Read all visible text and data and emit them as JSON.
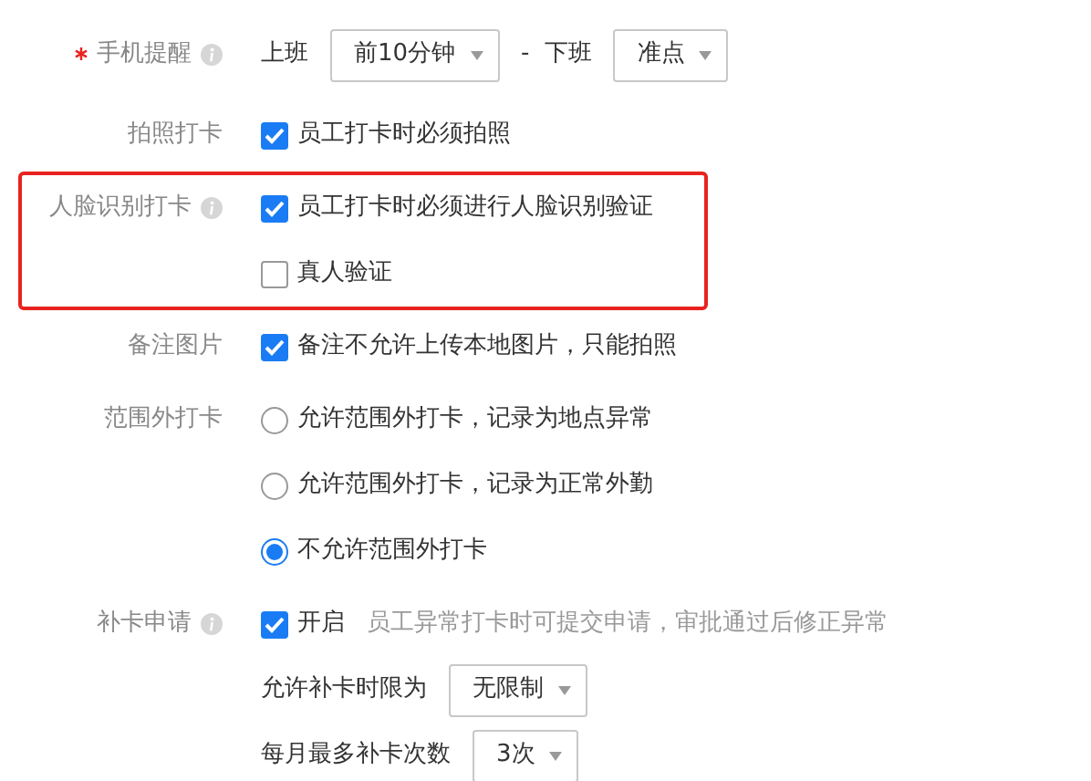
{
  "rows": [
    {
      "label": "手机提醒",
      "required": true,
      "info": true,
      "highlighted": false,
      "lines": [
        [
          {
            "kind": "text",
            "text": "上班"
          },
          {
            "kind": "select",
            "value": "前10分钟"
          },
          {
            "kind": "text",
            "text": "-"
          },
          {
            "kind": "text",
            "text": "下班"
          },
          {
            "kind": "select",
            "value": "准点"
          }
        ]
      ]
    },
    {
      "label": "拍照打卡",
      "required": false,
      "info": false,
      "highlighted": false,
      "lines": [
        [
          {
            "kind": "checkbox",
            "text": "员工打卡时必须拍照",
            "checked": true
          }
        ]
      ]
    },
    {
      "label": "人脸识别打卡",
      "required": false,
      "info": true,
      "highlighted": true,
      "lines": [
        [
          {
            "kind": "checkbox",
            "text": "员工打卡时必须进行人脸识别验证",
            "checked": true
          }
        ],
        [
          {
            "kind": "checkbox",
            "text": "真人验证",
            "checked": false
          }
        ]
      ]
    },
    {
      "label": "备注图片",
      "required": false,
      "info": false,
      "highlighted": false,
      "lines": [
        [
          {
            "kind": "checkbox",
            "text": "备注不允许上传本地图片，只能拍照",
            "checked": true
          }
        ]
      ]
    },
    {
      "label": "范围外打卡",
      "required": false,
      "info": false,
      "highlighted": false,
      "lines": [
        [
          {
            "kind": "radio",
            "text": "允许范围外打卡，记录为地点异常",
            "selected": false
          }
        ],
        [
          {
            "kind": "radio",
            "text": "允许范围外打卡，记录为正常外勤",
            "selected": false
          }
        ],
        [
          {
            "kind": "radio",
            "text": "不允许范围外打卡",
            "selected": true
          }
        ]
      ]
    },
    {
      "label": "补卡申请",
      "required": false,
      "info": true,
      "highlighted": false,
      "lines": [
        [
          {
            "kind": "checkbox",
            "text": "开启",
            "checked": true
          },
          {
            "kind": "hint",
            "text": "员工异常打卡时可提交申请，审批通过后修正异常"
          }
        ],
        [
          {
            "kind": "text",
            "text": "允许补卡时限为"
          },
          {
            "kind": "select",
            "value": "无限制"
          }
        ],
        [
          {
            "kind": "text",
            "text": "每月最多补卡次数"
          },
          {
            "kind": "select",
            "value": "3次"
          }
        ]
      ]
    }
  ]
}
